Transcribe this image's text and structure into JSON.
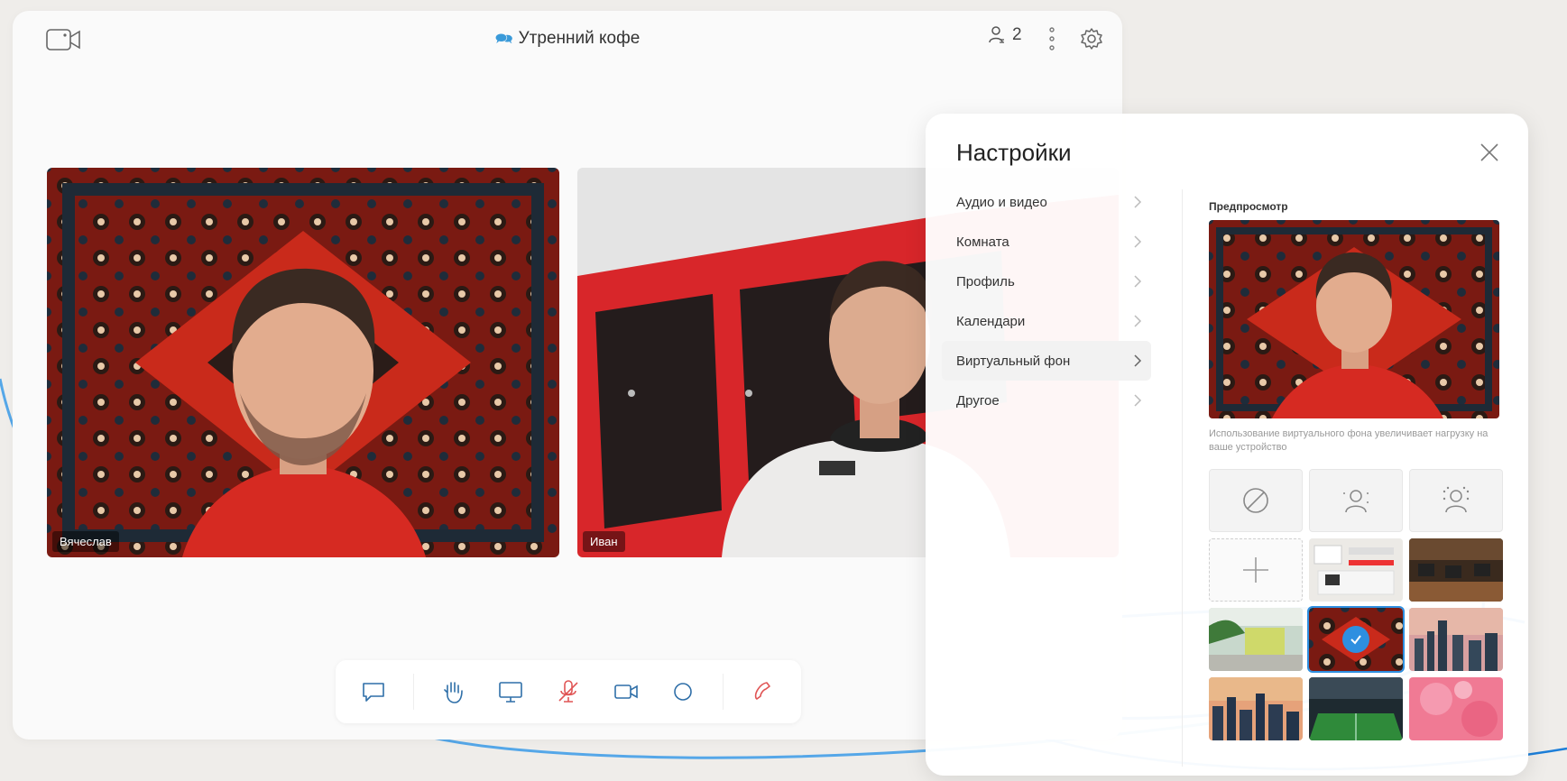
{
  "window": {
    "room_emoji": "🗪",
    "room_title": "Утренний кофе",
    "participants_count": "2"
  },
  "tiles": [
    {
      "name": "Вячеслав"
    },
    {
      "name": "Иван"
    }
  ],
  "controls": [
    "chat-icon",
    "raise-hand-icon",
    "screen-share-icon",
    "mic-muted-icon",
    "camera-icon",
    "record-icon",
    "hang-up-icon"
  ],
  "settings": {
    "title": "Настройки",
    "nav": [
      {
        "label": "Аудио и видео",
        "active": false
      },
      {
        "label": "Комната",
        "active": false
      },
      {
        "label": "Профиль",
        "active": false
      },
      {
        "label": "Календари",
        "active": false
      },
      {
        "label": "Виртуальный фон",
        "active": true
      },
      {
        "label": "Другое",
        "active": false
      }
    ],
    "preview_label": "Предпросмотр",
    "note": "Использование виртуального фона увеличивает нагрузку на ваше устройство",
    "background_options": [
      "none-icon",
      "blur-light-icon",
      "blur-strong-icon",
      "add-icon",
      "office-image",
      "workspace-image",
      "garden-image",
      "carpet-image",
      "city-skyline-image",
      "city-dusk-image",
      "stadium-image",
      "pink-bokeh-image"
    ],
    "selected_background": "carpet-image"
  },
  "colors": {
    "accent": "#2e8fe0",
    "hangup": "#e05555",
    "muted_mic": "#e05555",
    "background": "#efedea"
  }
}
